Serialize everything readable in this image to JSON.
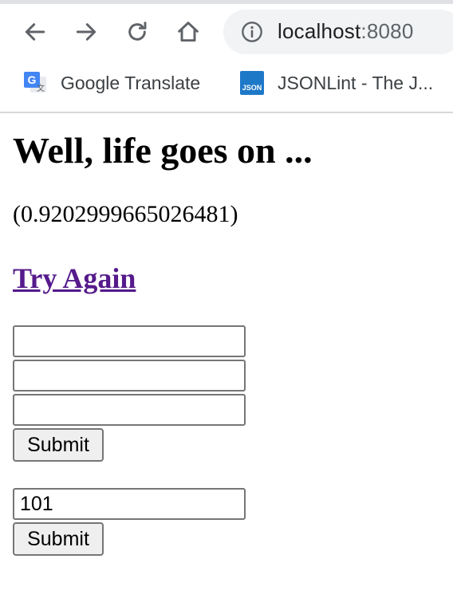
{
  "browser": {
    "url_host": "localhost",
    "url_port": ":8080",
    "bookmarks": [
      {
        "label": "Google Translate",
        "icon": "google-translate-icon"
      },
      {
        "label": "JSONLint - The J...",
        "icon": "jsonlint-icon",
        "icon_text": "JSON"
      }
    ]
  },
  "page": {
    "heading": "Well, life goes on ...",
    "value": "(0.9202999665026481)",
    "try_again_label": "Try Again",
    "form1": {
      "field1_value": "",
      "field2_value": "",
      "field3_value": "",
      "submit_label": "Submit"
    },
    "form2": {
      "field_value": "101",
      "submit_label": "Submit"
    }
  },
  "colors": {
    "link_visited": "#551a8b",
    "omnibox_bg": "#f1f3f4"
  }
}
